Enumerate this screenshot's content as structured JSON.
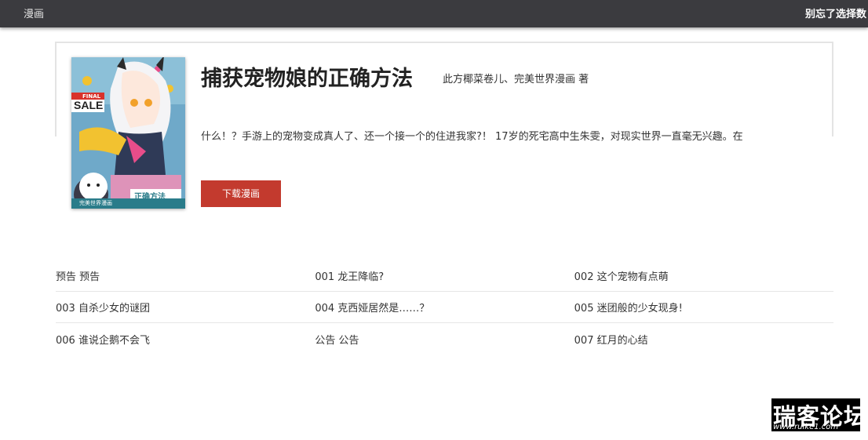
{
  "topbar": {
    "brand": "漫画",
    "notice": "别忘了选择数"
  },
  "comic": {
    "title": "捕获宠物娘的正确方法",
    "author": "此方椰菜卷儿、完美世界漫画 著",
    "description": "什么！？手游上的宠物变成真人了、还一个接一个的住进我家?！ 17岁的死宅高中生朱雯，对现实世界一直毫无兴趣。在",
    "cover": {
      "badge_top": "FINAL",
      "badge_main": "SALE",
      "logo_text": "正确方法",
      "publisher_text": "完美世界漫画",
      "colors": {
        "background": "#6fa9c9",
        "accent": "#f2c230",
        "pink": "#e84d8a",
        "red": "#d9322b"
      }
    },
    "download_label": "下载漫画"
  },
  "chapters": [
    [
      "预告 预告",
      "001 龙王降临?",
      "002 这个宠物有点萌"
    ],
    [
      "003 自杀少女的谜团",
      "004 克西娅居然是……？",
      "005 迷团般的少女现身!"
    ],
    [
      "006 谁说企鹅不会飞",
      "公告 公告",
      "007 红月的心结"
    ]
  ],
  "watermark": {
    "main": "瑞客论坛",
    "sub": "www.ruike1.com"
  },
  "colors": {
    "topbar": "#3b3b3f",
    "download_button": "#c33a2e",
    "border": "#e4e4e4"
  }
}
